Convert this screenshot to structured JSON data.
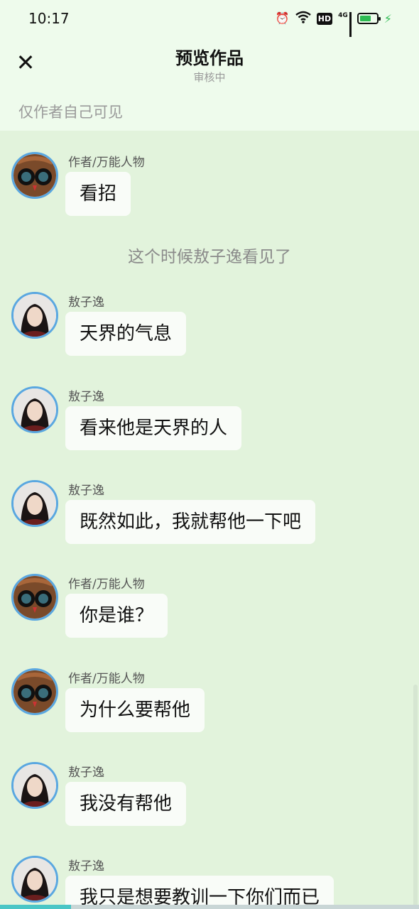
{
  "statusbar": {
    "time": "10:17",
    "hd": "HD",
    "network": "4G"
  },
  "header": {
    "title": "预览作品",
    "subtitle": "审核中",
    "close_icon": "close-icon",
    "visibility": "仅作者自己可见"
  },
  "messages": [
    {
      "type": "message",
      "speaker": "作者/万能人物",
      "avatar": "owl-avatar",
      "text": "看招"
    },
    {
      "type": "narration",
      "text": "这个时候敖子逸看见了"
    },
    {
      "type": "message",
      "speaker": "敖子逸",
      "avatar": "person-avatar",
      "text": "天界的气息"
    },
    {
      "type": "message",
      "speaker": "敖子逸",
      "avatar": "person-avatar",
      "text": "看来他是天界的人"
    },
    {
      "type": "message",
      "speaker": "敖子逸",
      "avatar": "person-avatar",
      "text": "既然如此，我就帮他一下吧"
    },
    {
      "type": "message",
      "speaker": "作者/万能人物",
      "avatar": "owl-avatar",
      "text": "你是谁？"
    },
    {
      "type": "message",
      "speaker": "作者/万能人物",
      "avatar": "owl-avatar",
      "text": "为什么要帮他"
    },
    {
      "type": "message",
      "speaker": "敖子逸",
      "avatar": "person-avatar",
      "text": "我没有帮他"
    },
    {
      "type": "message",
      "speaker": "敖子逸",
      "avatar": "person-avatar",
      "text": "我只是想要教训一下你们而已"
    }
  ]
}
